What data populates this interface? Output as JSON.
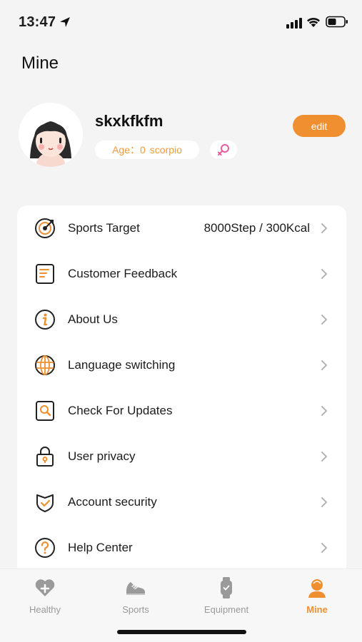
{
  "status_bar": {
    "time": "13:47"
  },
  "header": {
    "title": "Mine"
  },
  "profile": {
    "username": "skxkfkfm",
    "age_label": "Age：0",
    "zodiac": "scorpio",
    "edit_label": "edit"
  },
  "menu": {
    "items": [
      {
        "label": "Sports Target",
        "value": "8000Step / 300Kcal",
        "icon": "target-icon"
      },
      {
        "label": "Customer Feedback",
        "icon": "feedback-icon"
      },
      {
        "label": "About Us",
        "icon": "info-icon"
      },
      {
        "label": "Language switching",
        "icon": "globe-icon"
      },
      {
        "label": "Check For Updates",
        "icon": "update-search-icon"
      },
      {
        "label": "User privacy",
        "icon": "lock-icon"
      },
      {
        "label": "Account security",
        "icon": "shield-icon"
      },
      {
        "label": "Help Center",
        "icon": "help-icon"
      }
    ]
  },
  "tabs": [
    {
      "label": "Healthy",
      "icon": "heart-plus-icon",
      "active": false
    },
    {
      "label": "Sports",
      "icon": "sneaker-icon",
      "active": false
    },
    {
      "label": "Equipment",
      "icon": "watch-icon",
      "active": false
    },
    {
      "label": "Mine",
      "icon": "person-icon",
      "active": true
    }
  ],
  "colors": {
    "accent": "#ef8f2f",
    "background": "#f4f4f4",
    "card": "#ffffff",
    "tab_inactive": "#9a9a9a"
  }
}
